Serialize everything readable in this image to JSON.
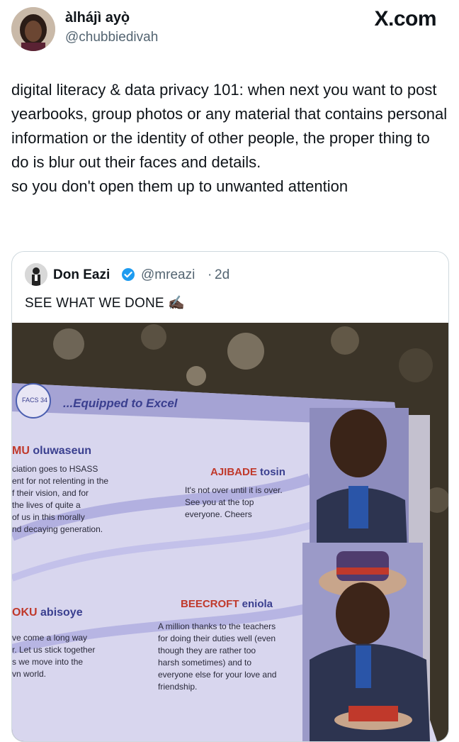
{
  "author": {
    "display_name": "àlhájì ayọ̀",
    "handle": "@chubbiedivah"
  },
  "brand": "X.com",
  "tweet": {
    "paragraph_1": "digital literacy & data privacy 101: when next you want to post yearbooks, group photos or any material that contains personal information or the identity of other people, the proper thing to do is blur out their faces and details.",
    "paragraph_2": "so you don't open them up to unwanted attention"
  },
  "quoted_tweet": {
    "display_name": "Don Eazi",
    "handle": "@mreazi",
    "separator": "·",
    "time": "2d",
    "text": "SEE WHAT WE DONE ✍🏿"
  },
  "yearbook": {
    "banner": "...Equipped to Excel",
    "logo_text": "FACS 34",
    "entry_1_surname": "MU",
    "entry_1_name": "oluwaseun",
    "entry_1_lines": [
      "ciation goes to HSASS",
      "ent for not relenting in the",
      "f their vision, and for",
      "the lives of quite a",
      "of us in this morally",
      "nd decaying generation."
    ],
    "entry_2_surname": "AJIBADE",
    "entry_2_name": "tosin",
    "entry_2_lines": [
      "It's not over until it is over.",
      "See you at the top",
      "everyone. Cheers"
    ],
    "entry_3_surname": "OKU",
    "entry_3_name": "abisoye",
    "entry_3_lines": [
      "ve come a long way",
      "r. Let us stick together",
      "s we move into the",
      "vn world."
    ],
    "entry_4_surname": "BEECROFT",
    "entry_4_name": "eniola",
    "entry_4_lines": [
      "A million thanks to the teachers",
      "for doing their duties well (even",
      "though they are rather too",
      "harsh sometimes) and to",
      "everyone else for your love and",
      "friendship."
    ]
  },
  "colors": {
    "verified": "#1d9bf0",
    "text_primary": "#0f1419",
    "text_secondary": "#536471",
    "border": "#cfd9de",
    "yearbook_red": "#c0392b",
    "yearbook_blue": "#3a3f8f"
  },
  "icons": {
    "verified": "verified-badge-icon"
  }
}
